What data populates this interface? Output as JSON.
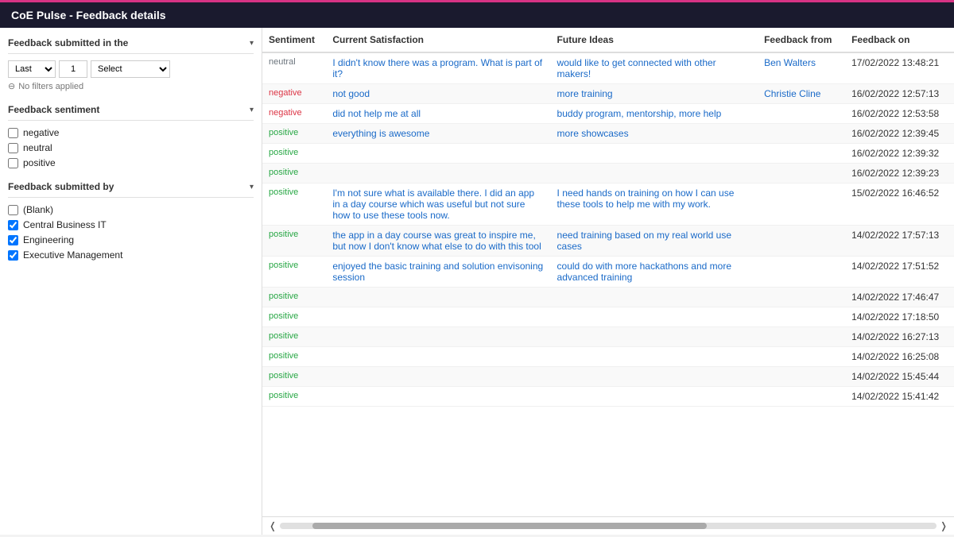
{
  "titleBar": {
    "label": "CoE Pulse - Feedback details",
    "accentColor": "#d63384"
  },
  "leftPanel": {
    "submittedInSection": {
      "label": "Feedback submitted in the",
      "lastLabel": "Last",
      "numberValue": "1",
      "selectPlaceholder": "Select",
      "noFilters": "No filters applied"
    },
    "sentimentSection": {
      "label": "Feedback sentiment",
      "items": [
        {
          "value": "negative",
          "label": "negative",
          "checked": false
        },
        {
          "value": "neutral",
          "label": "neutral",
          "checked": false
        },
        {
          "value": "positive",
          "label": "positive",
          "checked": false
        }
      ]
    },
    "submittedBySection": {
      "label": "Feedback submitted by",
      "items": [
        {
          "value": "blank",
          "label": "(Blank)",
          "checked": false
        },
        {
          "value": "central-business-it",
          "label": "Central Business IT",
          "checked": true
        },
        {
          "value": "engineering",
          "label": "Engineering",
          "checked": true
        },
        {
          "value": "executive-management",
          "label": "Executive Management",
          "checked": true
        }
      ]
    }
  },
  "table": {
    "columns": [
      {
        "key": "sentiment",
        "label": "Sentiment"
      },
      {
        "key": "currentSatisfaction",
        "label": "Current Satisfaction"
      },
      {
        "key": "futureIdeas",
        "label": "Future Ideas"
      },
      {
        "key": "feedbackFrom",
        "label": "Feedback from"
      },
      {
        "key": "feedbackOn",
        "label": "Feedback on"
      }
    ],
    "rows": [
      {
        "sentiment": "neutral",
        "sentimentClass": "sentiment-neutral",
        "currentSatisfaction": "I didn't know there was a program. What is part of it?",
        "futureIdeas": "would like to get connected with other makers!",
        "feedbackFrom": "Ben Walters",
        "feedbackOn": "17/02/2022 13:48:21",
        "highlight": false
      },
      {
        "sentiment": "negative",
        "sentimentClass": "sentiment-negative",
        "currentSatisfaction": "not good",
        "futureIdeas": "more training",
        "feedbackFrom": "Christie Cline",
        "feedbackOn": "16/02/2022 12:57:13",
        "highlight": false
      },
      {
        "sentiment": "negative",
        "sentimentClass": "sentiment-negative",
        "currentSatisfaction": "did not help me at all",
        "futureIdeas": "buddy program, mentorship, more help",
        "feedbackFrom": "",
        "feedbackOn": "16/02/2022 12:53:58",
        "highlight": false
      },
      {
        "sentiment": "positive",
        "sentimentClass": "sentiment-positive",
        "currentSatisfaction": "everything is awesome",
        "futureIdeas": "more showcases",
        "feedbackFrom": "",
        "feedbackOn": "16/02/2022 12:39:45",
        "highlight": true
      },
      {
        "sentiment": "positive",
        "sentimentClass": "sentiment-positive",
        "currentSatisfaction": "",
        "futureIdeas": "",
        "feedbackFrom": "",
        "feedbackOn": "16/02/2022 12:39:32",
        "highlight": false
      },
      {
        "sentiment": "positive",
        "sentimentClass": "sentiment-positive",
        "currentSatisfaction": "",
        "futureIdeas": "",
        "feedbackFrom": "",
        "feedbackOn": "16/02/2022 12:39:23",
        "highlight": true
      },
      {
        "sentiment": "positive",
        "sentimentClass": "sentiment-positive",
        "currentSatisfaction": "I'm not sure what is available there. I did an app in a day course which was useful but not sure how to use these tools now.",
        "futureIdeas": "I need hands on training on how I can use these tools to help me with my work.",
        "feedbackFrom": "",
        "feedbackOn": "15/02/2022 16:46:52",
        "highlight": false
      },
      {
        "sentiment": "positive",
        "sentimentClass": "sentiment-positive",
        "currentSatisfaction": "the app in a day course was great to inspire me, but now I don't know what else to do with this tool",
        "futureIdeas": "need training based on my real world use cases",
        "feedbackFrom": "",
        "feedbackOn": "14/02/2022 17:57:13",
        "highlight": true
      },
      {
        "sentiment": "positive",
        "sentimentClass": "sentiment-positive",
        "currentSatisfaction": "enjoyed the basic training and solution envisoning session",
        "futureIdeas": "could do with more hackathons and more advanced training",
        "feedbackFrom": "",
        "feedbackOn": "14/02/2022 17:51:52",
        "highlight": false
      },
      {
        "sentiment": "positive",
        "sentimentClass": "sentiment-positive",
        "currentSatisfaction": "",
        "futureIdeas": "",
        "feedbackFrom": "",
        "feedbackOn": "14/02/2022 17:46:47",
        "highlight": true
      },
      {
        "sentiment": "positive",
        "sentimentClass": "sentiment-positive",
        "currentSatisfaction": "",
        "futureIdeas": "",
        "feedbackFrom": "",
        "feedbackOn": "14/02/2022 17:18:50",
        "highlight": false
      },
      {
        "sentiment": "positive",
        "sentimentClass": "sentiment-positive",
        "currentSatisfaction": "",
        "futureIdeas": "",
        "feedbackFrom": "",
        "feedbackOn": "14/02/2022 16:27:13",
        "highlight": true
      },
      {
        "sentiment": "positive",
        "sentimentClass": "sentiment-positive",
        "currentSatisfaction": "",
        "futureIdeas": "",
        "feedbackFrom": "",
        "feedbackOn": "14/02/2022 16:25:08",
        "highlight": false
      },
      {
        "sentiment": "positive",
        "sentimentClass": "sentiment-positive",
        "currentSatisfaction": "",
        "futureIdeas": "",
        "feedbackFrom": "",
        "feedbackOn": "14/02/2022 15:45:44",
        "highlight": true
      },
      {
        "sentiment": "positive",
        "sentimentClass": "sentiment-positive",
        "currentSatisfaction": "",
        "futureIdeas": "",
        "feedbackFrom": "",
        "feedbackOn": "14/02/2022 15:41:42",
        "highlight": false
      }
    ]
  }
}
